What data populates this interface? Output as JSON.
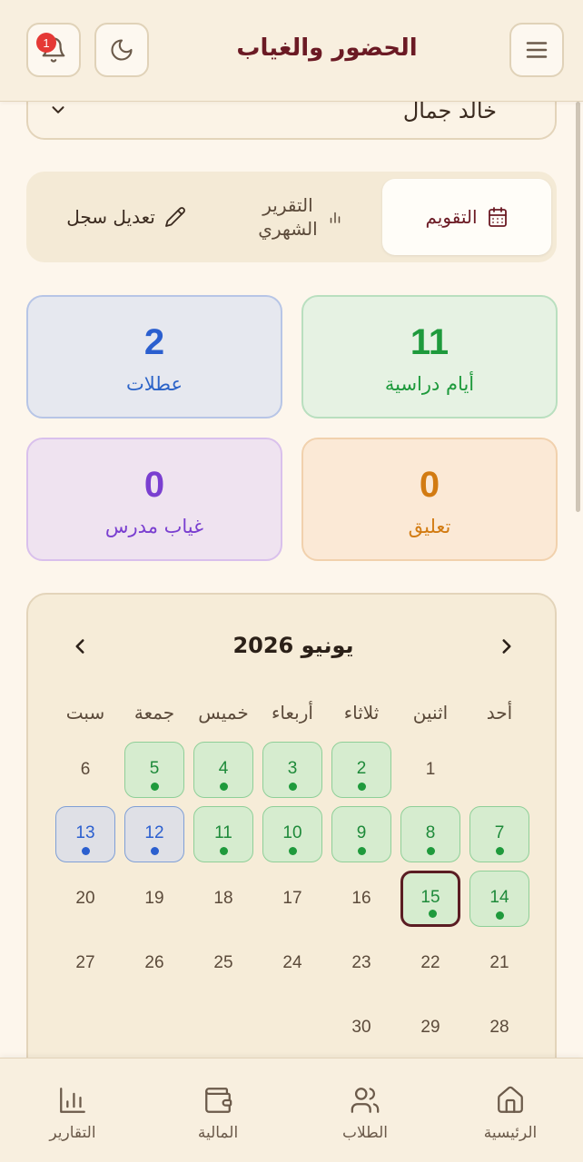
{
  "header": {
    "title": "الحضور والغياب",
    "notification_count": "1",
    "icons": {
      "menu": "menu-icon",
      "theme": "moon-icon",
      "notifications": "bell-icon"
    }
  },
  "student_selector": {
    "selected": "خالد جمال"
  },
  "tabs": {
    "calendar": "التقويم",
    "monthly_line1": "التقرير",
    "monthly_line2": "الشهري",
    "edit": "تعديل سجل"
  },
  "stats": {
    "school_days": {
      "value": "11",
      "label": "أيام دراسية",
      "color": "#1e9a3c"
    },
    "holidays": {
      "value": "2",
      "label": "عطلات",
      "color": "#2b5fcf"
    },
    "suspension": {
      "value": "0",
      "label": "تعليق",
      "color": "#d27b12"
    },
    "teacher_absence": {
      "value": "0",
      "label": "غياب مدرس",
      "color": "#7a3fd0"
    }
  },
  "calendar": {
    "month_title": "يونيو 2026",
    "weekdays": [
      "أحد",
      "اثنين",
      "ثلاثاء",
      "أربعاء",
      "خميس",
      "جمعة",
      "سبت"
    ],
    "weeks": [
      [
        null,
        {
          "d": "1",
          "s": "none"
        },
        {
          "d": "2",
          "s": "school"
        },
        {
          "d": "3",
          "s": "school"
        },
        {
          "d": "4",
          "s": "school"
        },
        {
          "d": "5",
          "s": "school"
        },
        {
          "d": "6",
          "s": "none"
        }
      ],
      [
        {
          "d": "7",
          "s": "school"
        },
        {
          "d": "8",
          "s": "school"
        },
        {
          "d": "9",
          "s": "school"
        },
        {
          "d": "10",
          "s": "school"
        },
        {
          "d": "11",
          "s": "school"
        },
        {
          "d": "12",
          "s": "holiday"
        },
        {
          "d": "13",
          "s": "holiday"
        }
      ],
      [
        {
          "d": "14",
          "s": "school"
        },
        {
          "d": "15",
          "s": "today"
        },
        {
          "d": "16",
          "s": "none"
        },
        {
          "d": "17",
          "s": "none"
        },
        {
          "d": "18",
          "s": "none"
        },
        {
          "d": "19",
          "s": "none"
        },
        {
          "d": "20",
          "s": "none"
        }
      ],
      [
        {
          "d": "21",
          "s": "none"
        },
        {
          "d": "22",
          "s": "none"
        },
        {
          "d": "23",
          "s": "none"
        },
        {
          "d": "24",
          "s": "none"
        },
        {
          "d": "25",
          "s": "none"
        },
        {
          "d": "26",
          "s": "none"
        },
        {
          "d": "27",
          "s": "none"
        }
      ],
      [
        {
          "d": "28",
          "s": "none"
        },
        {
          "d": "29",
          "s": "none"
        },
        {
          "d": "30",
          "s": "none"
        },
        null,
        null,
        null,
        null
      ]
    ]
  },
  "bottom_nav": {
    "home": "الرئيسية",
    "students": "الطلاب",
    "finance": "المالية",
    "reports": "التقارير"
  }
}
